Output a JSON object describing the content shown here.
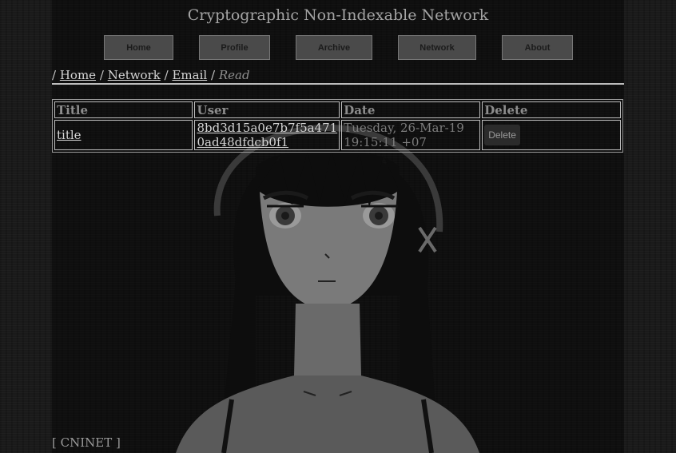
{
  "site": {
    "title": "Cryptographic Non-Indexable Network"
  },
  "nav": [
    {
      "label": "Home"
    },
    {
      "label": "Profile"
    },
    {
      "label": "Archive"
    },
    {
      "label": "Network"
    },
    {
      "label": "About"
    }
  ],
  "breadcrumb": {
    "sep": "/",
    "items": [
      {
        "label": "Home"
      },
      {
        "label": "Network"
      },
      {
        "label": "Email"
      }
    ],
    "current": "Read"
  },
  "table": {
    "headers": [
      "Title",
      "User",
      "Date",
      "Delete"
    ],
    "rows": [
      {
        "title": "title",
        "user": "8bd3d15a0e7b7f5a4710ad48dfdcb0f1",
        "user_line1": "8bd3d15a0e7b7f5a471",
        "user_line2": "0ad48dfdcb0f1",
        "date_line1": "Tuesday, 26-Mar-19",
        "date_line2": "19:15:11 +07",
        "delete_label": "Delete"
      }
    ]
  },
  "footer": {
    "text": "[ CNINET ]"
  },
  "colors": {
    "background": "#1a1a1a",
    "nav_button": "#4a4a4a",
    "link": "#d6d6d6",
    "muted_text": "#8d8d8d"
  },
  "background_image": "anime-girl-illustration"
}
